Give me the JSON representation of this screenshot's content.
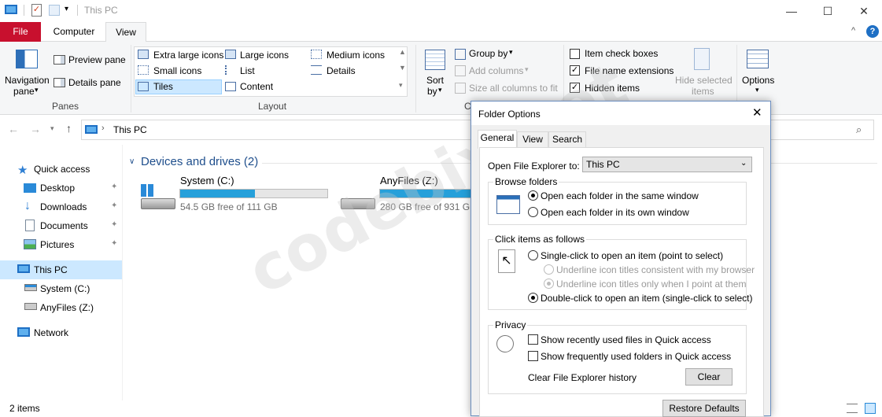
{
  "window": {
    "title": "This PC"
  },
  "tabs": {
    "file": "File",
    "computer": "Computer",
    "view": "View"
  },
  "ribbon": {
    "panes": {
      "navigation_pane": "Navigation",
      "navigation_pane_2": "pane",
      "preview_pane": "Preview pane",
      "details_pane": "Details pane",
      "group_label": "Panes"
    },
    "layout": {
      "extra_large": "Extra large icons",
      "large": "Large icons",
      "medium": "Medium icons",
      "small": "Small icons",
      "list": "List",
      "details": "Details",
      "tiles": "Tiles",
      "content": "Content",
      "group_label": "Layout"
    },
    "current_view": {
      "sort_by": "Sort",
      "sort_by_2": "by",
      "group_by": "Group by",
      "add_columns": "Add columns",
      "size_all": "Size all columns to fit",
      "group_label": "Cu"
    },
    "show_hide": {
      "item_check_boxes": "Item check boxes",
      "file_name_ext": "File name extensions",
      "hidden_items": "Hidden items",
      "hide_selected": "Hide selected",
      "hide_selected_2": "items"
    },
    "options": "Options"
  },
  "address": {
    "path": "This PC",
    "help": "?"
  },
  "nav": {
    "quick_access": "Quick access",
    "desktop": "Desktop",
    "downloads": "Downloads",
    "documents": "Documents",
    "pictures": "Pictures",
    "this_pc": "This PC",
    "system_c": "System (C:)",
    "anyfiles_z": "AnyFiles (Z:)",
    "network": "Network"
  },
  "content": {
    "section_title": "Devices and drives (2)",
    "drives": [
      {
        "name": "System (C:)",
        "free": "54.5 GB free of 111 GB",
        "used_fraction": 0.51
      },
      {
        "name": "AnyFiles (Z:)",
        "free": "280 GB free of 931 GB",
        "used_fraction": 0.7
      }
    ]
  },
  "status": {
    "items": "2 items"
  },
  "dialog": {
    "title": "Folder Options",
    "tabs": {
      "general": "General",
      "view": "View",
      "search": "Search"
    },
    "open_label": "Open File Explorer to:",
    "open_value": "This PC",
    "browse": {
      "legend": "Browse folders",
      "same": "Open each folder in the same window",
      "own": "Open each folder in its own window"
    },
    "click": {
      "legend": "Click items as follows",
      "single": "Single-click to open an item (point to select)",
      "underline_consistent": "Underline icon titles consistent with my browser",
      "underline_point": "Underline icon titles only when I point at them",
      "double": "Double-click to open an item (single-click to select)"
    },
    "privacy": {
      "legend": "Privacy",
      "recent_files": "Show recently used files in Quick access",
      "frequent_folders": "Show frequently used folders in Quick access",
      "clear_label": "Clear File Explorer history",
      "clear_button": "Clear"
    },
    "restore": "Restore Defaults"
  },
  "watermark": "codebix.net",
  "colors": {
    "file_tab": "#c8102e",
    "accent": "#26a0da",
    "selection": "#cce8ff",
    "link": "#1e4e8c"
  }
}
